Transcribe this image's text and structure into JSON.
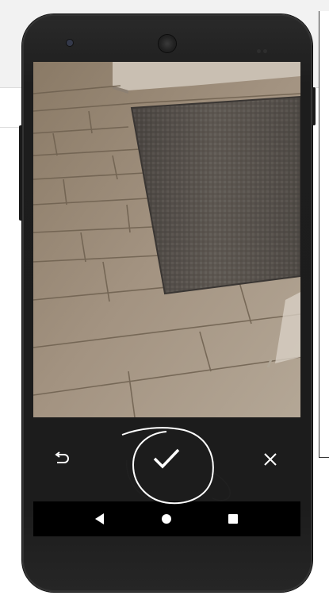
{
  "app": {
    "screen": "camera-photo-review"
  },
  "controls": {
    "retake_icon": "undo-arrow-icon",
    "confirm_icon": "checkmark-icon",
    "cancel_icon": "close-x-icon"
  },
  "navigation": {
    "back_icon": "triangle-back-icon",
    "home_icon": "circle-home-icon",
    "recents_icon": "square-recents-icon"
  },
  "colors": {
    "controls_background": "#1c1c1c",
    "navigation_background": "#000000",
    "icon_color": "#ffffff",
    "device_body": "#1d1d1d"
  }
}
